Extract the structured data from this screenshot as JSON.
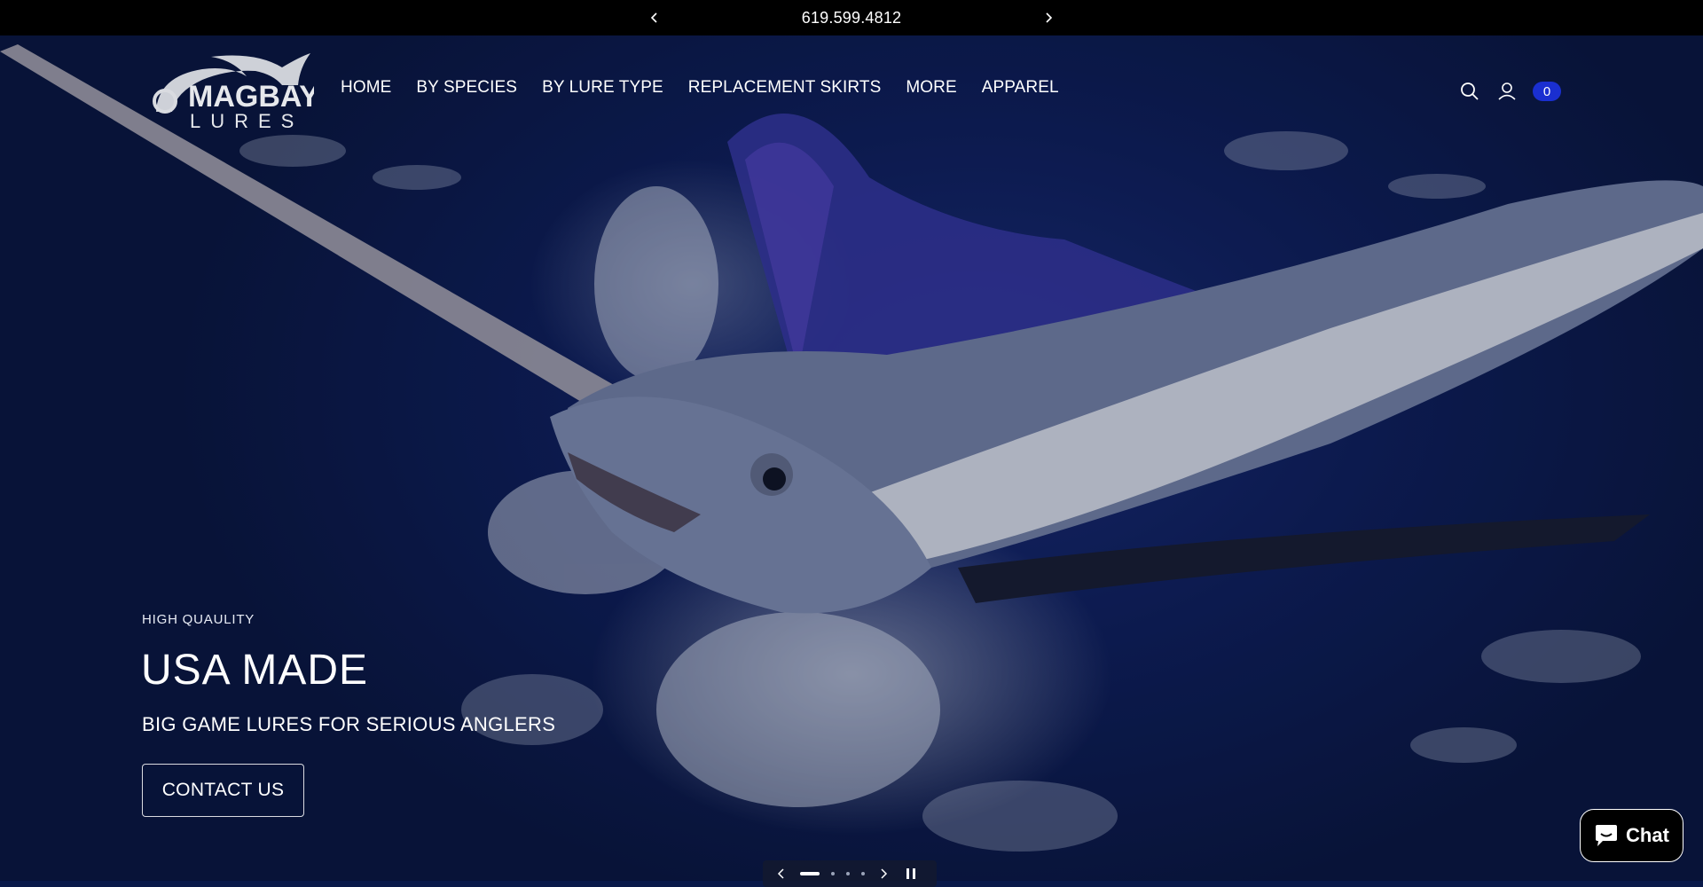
{
  "announcement": {
    "text": "619.599.4812",
    "prev_icon": "chevron-left-icon",
    "next_icon": "chevron-right-icon"
  },
  "header": {
    "logo": {
      "line1": "MAGBAY",
      "line2": "LURES"
    },
    "nav": [
      {
        "label": "HOME"
      },
      {
        "label": "BY SPECIES"
      },
      {
        "label": "BY LURE TYPE"
      },
      {
        "label": "REPLACEMENT SKIRTS"
      },
      {
        "label": "MORE"
      },
      {
        "label": "APPAREL"
      }
    ],
    "icons": [
      "search-icon",
      "account-icon"
    ],
    "cart_count": "0",
    "cart_color": "#1a2fd0"
  },
  "hero": {
    "eyebrow": "HIGH QUAULITY",
    "headline": "USA MADE",
    "subheading": "BIG GAME LURES FOR SERIOUS ANGLERS",
    "cta_label": "CONTACT US"
  },
  "slider": {
    "slide_count": 4,
    "active_slide": 1,
    "prev_icon": "chevron-left-icon",
    "next_icon": "chevron-right-icon",
    "pause_icon": "pause-icon"
  },
  "chat": {
    "label": "Chat",
    "icon": "chat-bubble-icon"
  }
}
